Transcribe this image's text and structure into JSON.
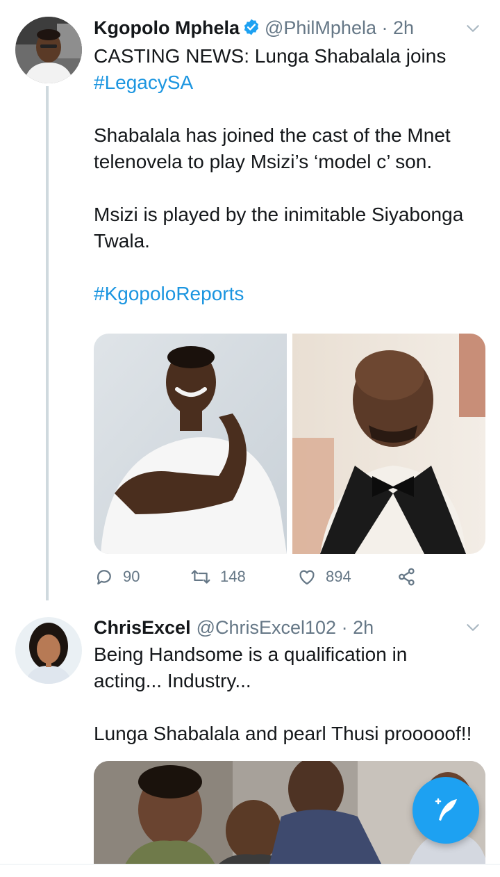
{
  "tweets": [
    {
      "display_name": "Kgopolo Mphela",
      "handle": "@PhilMphela",
      "separator": " · ",
      "time": "2h",
      "verified": true,
      "lines": [
        "CASTING NEWS: Lunga Shabalala joins",
        "#LegacySA",
        "Shabalala has joined the cast of the Mnet",
        "telenovela to play Msizi’s ‘model c’ son.",
        "Msizi is played by the inimitable Siyabonga",
        "Twala.",
        "#KgopoloReports"
      ],
      "stats": {
        "replies": "90",
        "retweets": "148",
        "likes": "894"
      }
    },
    {
      "display_name": "ChrisExcel",
      "handle": "@ChrisExcel102",
      "separator": " · ",
      "time": "2h",
      "verified": false,
      "lines": [
        "Being Handsome is a qualification in",
        "acting... Industry...",
        "Lunga Shabalala and pearl Thusi prooooof!!"
      ]
    }
  ],
  "colors": {
    "link": "#1b95e0",
    "muted": "#657786",
    "fab": "#1da1f2",
    "thread_line": "#cfd9de"
  },
  "icons": [
    "verified-badge-icon",
    "chevron-down-icon",
    "reply-icon",
    "retweet-icon",
    "like-icon",
    "share-icon",
    "compose-tweet-icon"
  ]
}
